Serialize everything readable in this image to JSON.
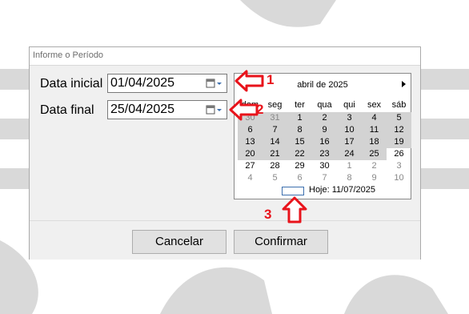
{
  "dialog": {
    "title": "Informe o Período",
    "start_label": "Data inicial",
    "start_value": "01/04/2025",
    "end_label": "Data final",
    "end_value": "25/04/2025",
    "cancel_label": "Cancelar",
    "confirm_label": "Confirmar"
  },
  "calendar": {
    "month_title": "abril de 2025",
    "weekdays": [
      "dom",
      "seg",
      "ter",
      "qua",
      "qui",
      "sex",
      "sáb"
    ],
    "weeks": [
      [
        {
          "d": "30",
          "o": true,
          "s": true
        },
        {
          "d": "31",
          "o": true,
          "s": true
        },
        {
          "d": "1",
          "s": true
        },
        {
          "d": "2",
          "s": true
        },
        {
          "d": "3",
          "s": true
        },
        {
          "d": "4",
          "s": true
        },
        {
          "d": "5",
          "s": true
        }
      ],
      [
        {
          "d": "6",
          "s": true
        },
        {
          "d": "7",
          "s": true
        },
        {
          "d": "8",
          "s": true
        },
        {
          "d": "9",
          "s": true
        },
        {
          "d": "10",
          "s": true
        },
        {
          "d": "11",
          "s": true
        },
        {
          "d": "12",
          "s": true
        }
      ],
      [
        {
          "d": "13",
          "s": true
        },
        {
          "d": "14",
          "s": true
        },
        {
          "d": "15",
          "s": true
        },
        {
          "d": "16",
          "s": true
        },
        {
          "d": "17",
          "s": true
        },
        {
          "d": "18",
          "s": true
        },
        {
          "d": "19",
          "s": true
        }
      ],
      [
        {
          "d": "20",
          "s": true
        },
        {
          "d": "21",
          "s": true
        },
        {
          "d": "22",
          "s": true
        },
        {
          "d": "23",
          "s": true
        },
        {
          "d": "24",
          "s": true
        },
        {
          "d": "25",
          "s": true
        },
        {
          "d": "26"
        }
      ],
      [
        {
          "d": "27"
        },
        {
          "d": "28"
        },
        {
          "d": "29"
        },
        {
          "d": "30"
        },
        {
          "d": "1",
          "o": true
        },
        {
          "d": "2",
          "o": true
        },
        {
          "d": "3",
          "o": true
        }
      ],
      [
        {
          "d": "4",
          "o": true
        },
        {
          "d": "5",
          "o": true
        },
        {
          "d": "6",
          "o": true
        },
        {
          "d": "7",
          "o": true
        },
        {
          "d": "8",
          "o": true
        },
        {
          "d": "9",
          "o": true
        },
        {
          "d": "10",
          "o": true
        }
      ]
    ],
    "today_label": "Hoje: 11/07/2025"
  },
  "annotations": {
    "marker_1": "1",
    "marker_2": "2",
    "marker_3": "3",
    "color": "#e8131b"
  },
  "colors": {
    "selection": "#d3d3d3",
    "today_outline": "#3c6fae"
  }
}
